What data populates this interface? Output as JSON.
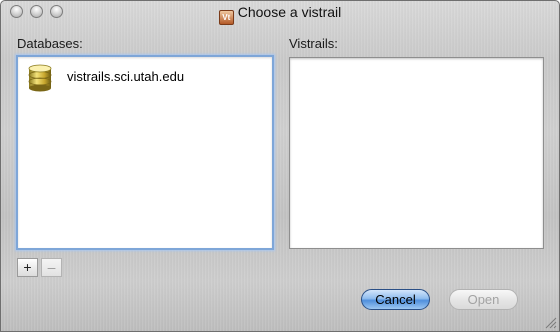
{
  "window": {
    "title": "Choose a vistrail",
    "title_icon_text": "Vt"
  },
  "databases": {
    "label": "Databases:",
    "items": [
      {
        "label": "vistrails.sci.utah.edu",
        "icon": "database-icon"
      }
    ],
    "add_label": "+",
    "remove_label": "–"
  },
  "vistrails": {
    "label": "Vistrails:",
    "items": []
  },
  "buttons": {
    "cancel_label": "Cancel",
    "open_label": "Open"
  },
  "colors": {
    "default_button": "#4f8fdc",
    "focus_ring": "#7ea6d8"
  }
}
